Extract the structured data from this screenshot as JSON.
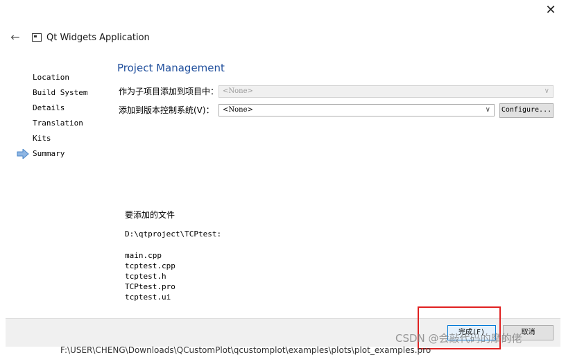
{
  "window": {
    "title": "Qt Widgets Application",
    "close_glyph": "✕",
    "back_glyph": "←"
  },
  "steps": [
    {
      "label": "Location"
    },
    {
      "label": "Build System"
    },
    {
      "label": "Details"
    },
    {
      "label": "Translation"
    },
    {
      "label": "Kits"
    },
    {
      "label": "Summary"
    }
  ],
  "current_step": "Summary",
  "page": {
    "title": "Project Management",
    "subproject_label": "作为子项目添加到项目中：",
    "subproject_value": "<None>",
    "vcs_label": "添加到版本控制系统(V)：",
    "vcs_value": "<None>",
    "configure_label": "Configure...",
    "dropdown_glyph": "∨"
  },
  "files": {
    "heading": "要添加的文件",
    "directory": "D:\\qtproject\\TCPtest:",
    "items": [
      "main.cpp",
      "tcptest.cpp",
      "tcptest.h",
      "TCPtest.pro",
      "tcptest.ui"
    ]
  },
  "footer": {
    "finish_label": "完成(F)",
    "cancel_label": "取消"
  },
  "watermark": "CSDN @会敲代码的摩的佬",
  "background_path": "F:\\USER\\CHENG\\Downloads\\QCustomPlot\\qcustomplot\\examples\\plots\\plot_examples.pro",
  "colors": {
    "section_title": "#1f4e9c",
    "step_arrow": "#4a86c8",
    "highlight_box": "#e02020"
  }
}
